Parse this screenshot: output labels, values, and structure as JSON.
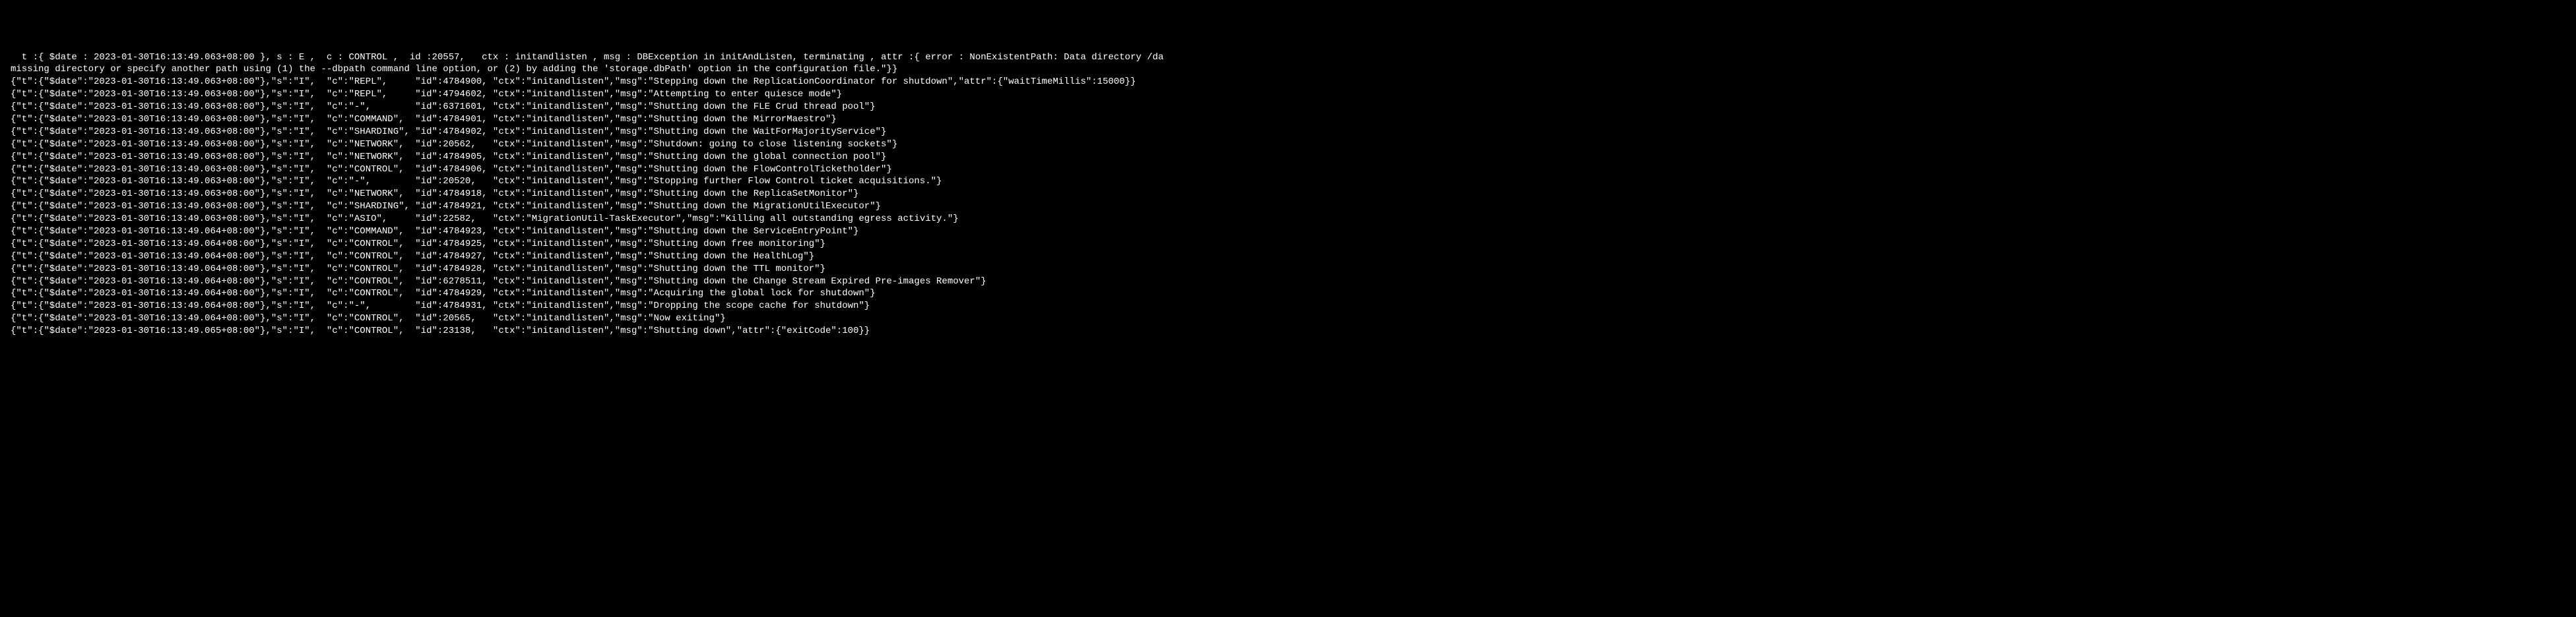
{
  "lines": [
    "  t :{ $date : 2023-01-30T16:13:49.063+08:00 }, s : E ,  c : CONTROL ,  id :20557,   ctx : initandlisten , msg : DBException in initAndListen, terminating , attr :{ error : NonExistentPath: Data directory /da",
    "missing directory or specify another path using (1) the --dbpath command line option, or (2) by adding the 'storage.dbPath' option in the configuration file.\"}}",
    "{\"t\":{\"$date\":\"2023-01-30T16:13:49.063+08:00\"},\"s\":\"I\",  \"c\":\"REPL\",     \"id\":4784900, \"ctx\":\"initandlisten\",\"msg\":\"Stepping down the ReplicationCoordinator for shutdown\",\"attr\":{\"waitTimeMillis\":15000}}",
    "{\"t\":{\"$date\":\"2023-01-30T16:13:49.063+08:00\"},\"s\":\"I\",  \"c\":\"REPL\",     \"id\":4794602, \"ctx\":\"initandlisten\",\"msg\":\"Attempting to enter quiesce mode\"}",
    "{\"t\":{\"$date\":\"2023-01-30T16:13:49.063+08:00\"},\"s\":\"I\",  \"c\":\"-\",        \"id\":6371601, \"ctx\":\"initandlisten\",\"msg\":\"Shutting down the FLE Crud thread pool\"}",
    "{\"t\":{\"$date\":\"2023-01-30T16:13:49.063+08:00\"},\"s\":\"I\",  \"c\":\"COMMAND\",  \"id\":4784901, \"ctx\":\"initandlisten\",\"msg\":\"Shutting down the MirrorMaestro\"}",
    "{\"t\":{\"$date\":\"2023-01-30T16:13:49.063+08:00\"},\"s\":\"I\",  \"c\":\"SHARDING\", \"id\":4784902, \"ctx\":\"initandlisten\",\"msg\":\"Shutting down the WaitForMajorityService\"}",
    "{\"t\":{\"$date\":\"2023-01-30T16:13:49.063+08:00\"},\"s\":\"I\",  \"c\":\"NETWORK\",  \"id\":20562,   \"ctx\":\"initandlisten\",\"msg\":\"Shutdown: going to close listening sockets\"}",
    "{\"t\":{\"$date\":\"2023-01-30T16:13:49.063+08:00\"},\"s\":\"I\",  \"c\":\"NETWORK\",  \"id\":4784905, \"ctx\":\"initandlisten\",\"msg\":\"Shutting down the global connection pool\"}",
    "{\"t\":{\"$date\":\"2023-01-30T16:13:49.063+08:00\"},\"s\":\"I\",  \"c\":\"CONTROL\",  \"id\":4784906, \"ctx\":\"initandlisten\",\"msg\":\"Shutting down the FlowControlTicketholder\"}",
    "{\"t\":{\"$date\":\"2023-01-30T16:13:49.063+08:00\"},\"s\":\"I\",  \"c\":\"-\",        \"id\":20520,   \"ctx\":\"initandlisten\",\"msg\":\"Stopping further Flow Control ticket acquisitions.\"}",
    "{\"t\":{\"$date\":\"2023-01-30T16:13:49.063+08:00\"},\"s\":\"I\",  \"c\":\"NETWORK\",  \"id\":4784918, \"ctx\":\"initandlisten\",\"msg\":\"Shutting down the ReplicaSetMonitor\"}",
    "{\"t\":{\"$date\":\"2023-01-30T16:13:49.063+08:00\"},\"s\":\"I\",  \"c\":\"SHARDING\", \"id\":4784921, \"ctx\":\"initandlisten\",\"msg\":\"Shutting down the MigrationUtilExecutor\"}",
    "{\"t\":{\"$date\":\"2023-01-30T16:13:49.063+08:00\"},\"s\":\"I\",  \"c\":\"ASIO\",     \"id\":22582,   \"ctx\":\"MigrationUtil-TaskExecutor\",\"msg\":\"Killing all outstanding egress activity.\"}",
    "{\"t\":{\"$date\":\"2023-01-30T16:13:49.064+08:00\"},\"s\":\"I\",  \"c\":\"COMMAND\",  \"id\":4784923, \"ctx\":\"initandlisten\",\"msg\":\"Shutting down the ServiceEntryPoint\"}",
    "{\"t\":{\"$date\":\"2023-01-30T16:13:49.064+08:00\"},\"s\":\"I\",  \"c\":\"CONTROL\",  \"id\":4784925, \"ctx\":\"initandlisten\",\"msg\":\"Shutting down free monitoring\"}",
    "{\"t\":{\"$date\":\"2023-01-30T16:13:49.064+08:00\"},\"s\":\"I\",  \"c\":\"CONTROL\",  \"id\":4784927, \"ctx\":\"initandlisten\",\"msg\":\"Shutting down the HealthLog\"}",
    "{\"t\":{\"$date\":\"2023-01-30T16:13:49.064+08:00\"},\"s\":\"I\",  \"c\":\"CONTROL\",  \"id\":4784928, \"ctx\":\"initandlisten\",\"msg\":\"Shutting down the TTL monitor\"}",
    "{\"t\":{\"$date\":\"2023-01-30T16:13:49.064+08:00\"},\"s\":\"I\",  \"c\":\"CONTROL\",  \"id\":6278511, \"ctx\":\"initandlisten\",\"msg\":\"Shutting down the Change Stream Expired Pre-images Remover\"}",
    "{\"t\":{\"$date\":\"2023-01-30T16:13:49.064+08:00\"},\"s\":\"I\",  \"c\":\"CONTROL\",  \"id\":4784929, \"ctx\":\"initandlisten\",\"msg\":\"Acquiring the global lock for shutdown\"}",
    "{\"t\":{\"$date\":\"2023-01-30T16:13:49.064+08:00\"},\"s\":\"I\",  \"c\":\"-\",        \"id\":4784931, \"ctx\":\"initandlisten\",\"msg\":\"Dropping the scope cache for shutdown\"}",
    "{\"t\":{\"$date\":\"2023-01-30T16:13:49.064+08:00\"},\"s\":\"I\",  \"c\":\"CONTROL\",  \"id\":20565,   \"ctx\":\"initandlisten\",\"msg\":\"Now exiting\"}",
    "{\"t\":{\"$date\":\"2023-01-30T16:13:49.065+08:00\"},\"s\":\"I\",  \"c\":\"CONTROL\",  \"id\":23138,   \"ctx\":\"initandlisten\",\"msg\":\"Shutting down\",\"attr\":{\"exitCode\":100}}"
  ]
}
